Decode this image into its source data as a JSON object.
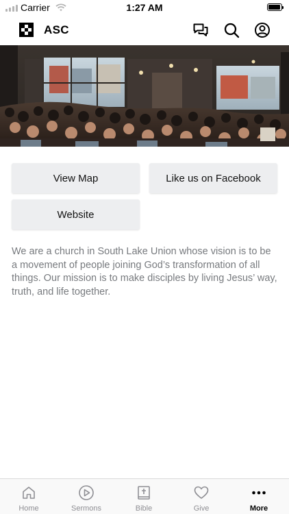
{
  "status_bar": {
    "carrier": "Carrier",
    "time": "1:27 AM"
  },
  "header": {
    "title": "ASC",
    "icons": [
      "chat-icon",
      "search-icon",
      "profile-icon"
    ]
  },
  "buttons": {
    "view_map": "View Map",
    "facebook": "Like us on Facebook",
    "website": "Website"
  },
  "description": "We are a church in South Lake Union whose vision is to be a movement of people joining God’s transformation of all things. Our mission is to make disciples by living Jesus’ way, truth, and life together.",
  "tabs": [
    {
      "label": "Home",
      "icon": "home-icon",
      "active": false
    },
    {
      "label": "Sermons",
      "icon": "play-icon",
      "active": false
    },
    {
      "label": "Bible",
      "icon": "bible-icon",
      "active": false
    },
    {
      "label": "Give",
      "icon": "heart-icon",
      "active": false
    },
    {
      "label": "More",
      "icon": "more-icon",
      "active": true
    }
  ],
  "colors": {
    "button_bg": "#edeef0",
    "description_text": "#777a7e",
    "tab_inactive": "#8e8e93",
    "tab_active": "#000000"
  }
}
